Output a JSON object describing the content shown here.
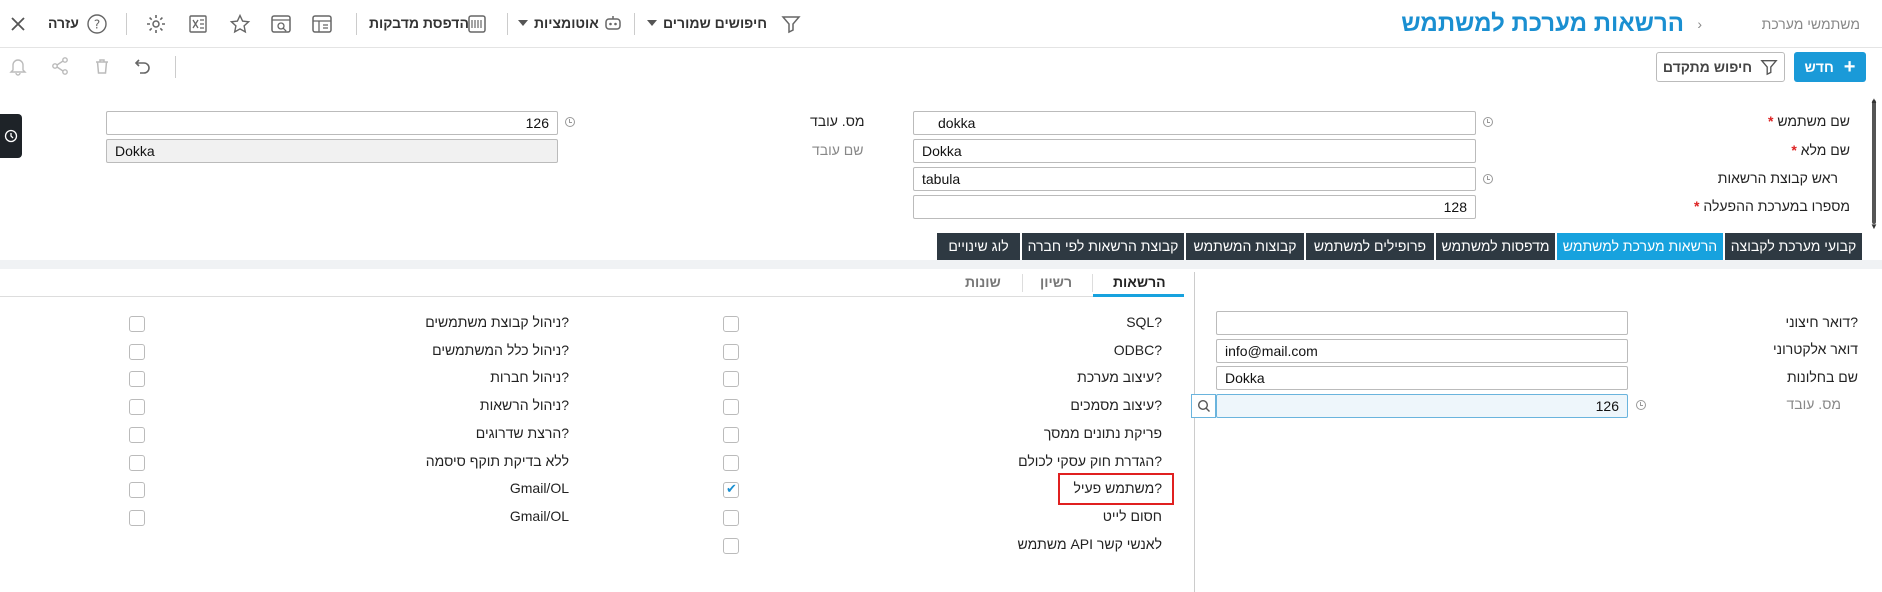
{
  "topbar": {
    "breadcrumb": "משתמשי מערכת",
    "title": "הרשאות מערכת למשתמש",
    "saved_searches": "חיפושים שמורים",
    "automations": "אוטומציות",
    "label_print": "הדפסת מדבקות",
    "help": "עזרה"
  },
  "toolbar": {
    "new_label": "חדש",
    "advanced_search": "חיפוש מתקדם"
  },
  "form": {
    "username_label": "שם משתמש",
    "username": "dokka",
    "fullname_label": "שם מלא",
    "fullname": "Dokka",
    "group_head_label": "ראש קבוצת הרשאות",
    "group_head": "tabula",
    "op_number_label": "מספרו במערכת ההפעלה",
    "op_number": "128",
    "employee_no_label": "מס. עובד",
    "employee_no": "126",
    "employee_name_label": "שם עובד",
    "employee_name": "Dokka"
  },
  "tabs": [
    "קבועי מערכת לקבוצה",
    "הרשאות מערכת למשתמש",
    "מדפסות למשתמש",
    "פרופילים למשתמש",
    "קבוצות המשתמש",
    "קבוצת הרשאות לפי חברה",
    "לוג שינויים"
  ],
  "subtabs": [
    "הרשאות",
    "רשיון",
    "שונות"
  ],
  "details": {
    "external_mail_label": "דואר חיצוני?",
    "external_mail": "",
    "email_label": "דואר אלקטרוני",
    "email": "info@mail.com",
    "window_name_label": "שם בחלונות",
    "window_name": "Dokka",
    "employee_no_label": "מס. עובד",
    "employee_no": "126"
  },
  "permissions_col1": [
    {
      "label": "SQL?",
      "checked": false
    },
    {
      "label": "ODBC?",
      "checked": false
    },
    {
      "label": "עיצוב מערכת?",
      "checked": false
    },
    {
      "label": "עיצוב מסמכים?",
      "checked": false
    },
    {
      "label": "פריקת נתונים ממסך",
      "checked": false
    },
    {
      "label": "הגדרת חוק עסקי לכולם?",
      "checked": false
    },
    {
      "label": "משתמש פעיל?",
      "checked": true
    },
    {
      "label": "חסום לייט",
      "checked": false
    },
    {
      "label": "משתמש API לאנשי קשר",
      "checked": false
    }
  ],
  "permissions_col2": [
    {
      "label": "ניהול קבוצת משתמשים?",
      "checked": false
    },
    {
      "label": "ניהול כלל המשתמשים?",
      "checked": false
    },
    {
      "label": "ניהול חברות?",
      "checked": false
    },
    {
      "label": "ניהול הרשאות?",
      "checked": false
    },
    {
      "label": "הרצת שדרוגים?",
      "checked": false
    },
    {
      "label": "ללא בדיקת תוקף סיסמה",
      "checked": false
    },
    {
      "label": "Gmail/OL",
      "checked": false
    },
    {
      "label": "Gmail/OL",
      "checked": false
    }
  ],
  "colors": {
    "accent": "#1a9ad8",
    "dark_tab": "#2e3942",
    "highlight": "#e02020"
  }
}
